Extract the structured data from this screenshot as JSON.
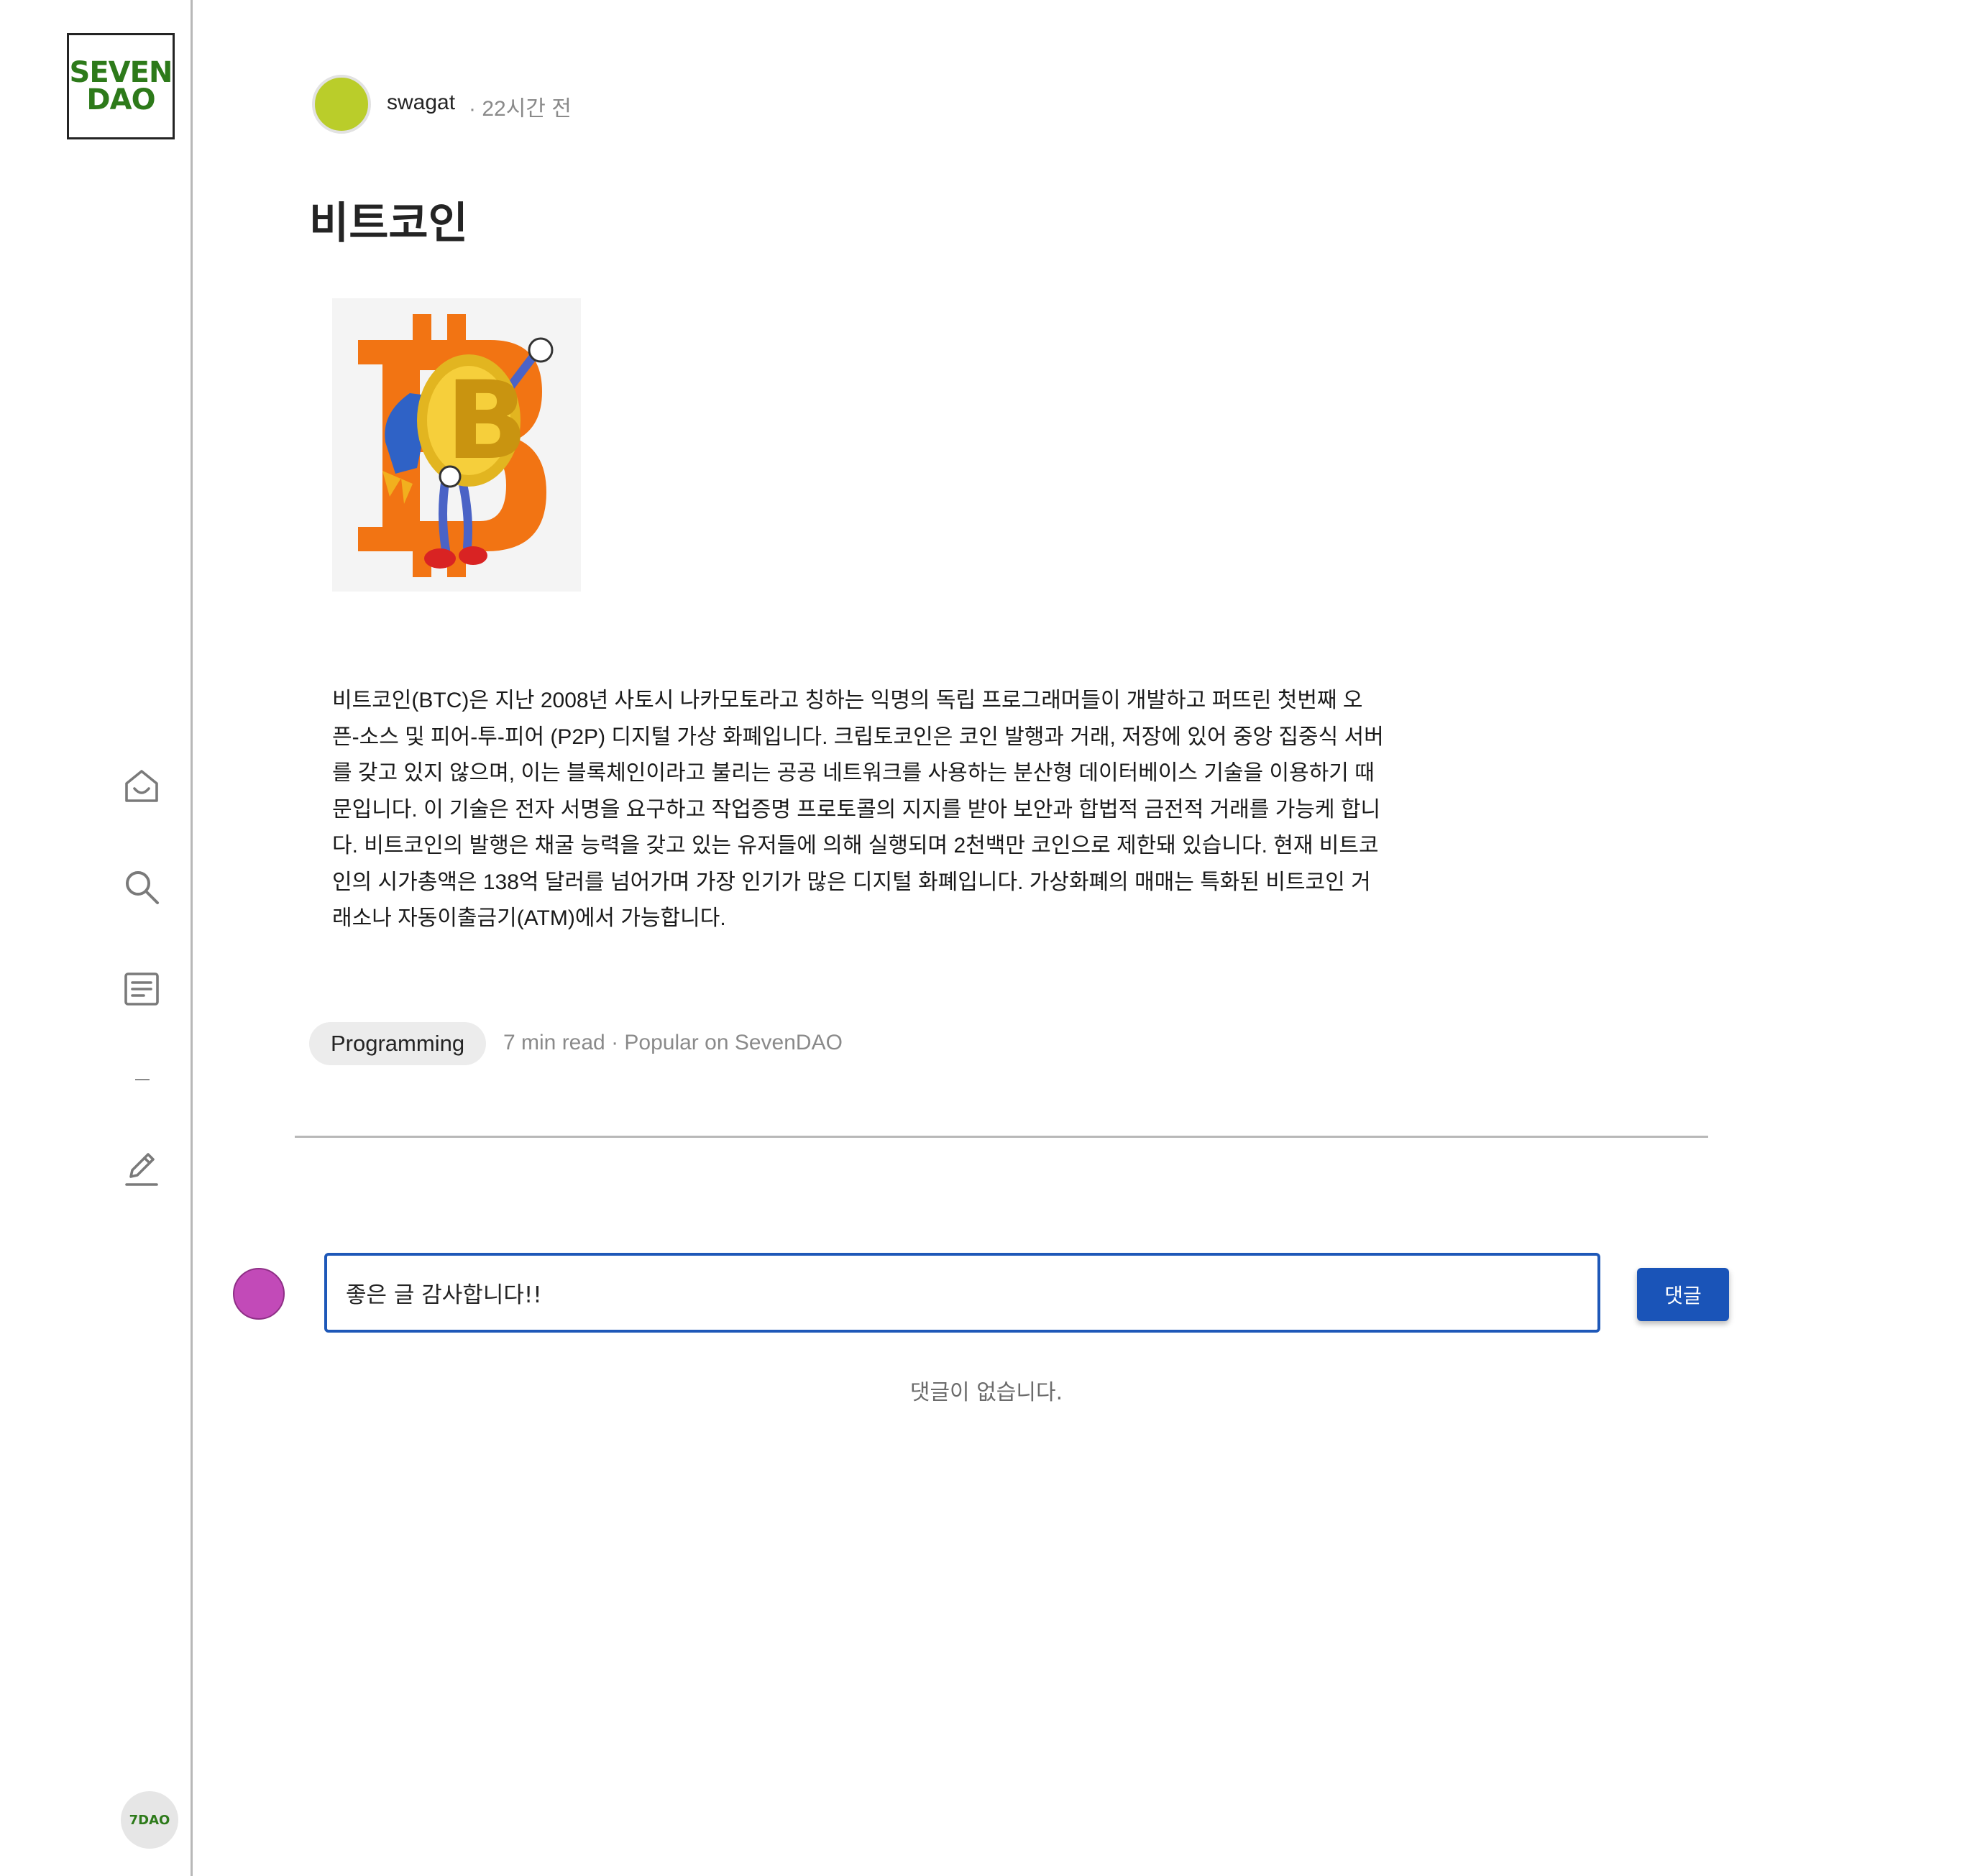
{
  "sidebar": {
    "logo_line1": "SEVEN",
    "logo_line2": "DAO",
    "nav_icons": [
      "home-icon",
      "search-icon",
      "list-icon",
      "write-icon"
    ],
    "profile_badge": "7DAO"
  },
  "post": {
    "author": "swagat",
    "time": "· 22시간 전",
    "title": "비트코인",
    "body": "비트코인(BTC)은 지난 2008년 사토시 나카모토라고 칭하는 익명의 독립 프로그래머들이 개발하고 퍼뜨린 첫번째 오픈-소스 및 피어-투-피어 (P2P) 디지털 가상 화폐입니다. 크립토코인은 코인 발행과 거래, 저장에 있어 중앙 집중식 서버를 갖고 있지 않으며, 이는 블록체인이라고 불리는 공공 네트워크를 사용하는 분산형 데이터베이스 기술을 이용하기 때문입니다. 이 기술은 전자 서명을 요구하고 작업증명 프로토콜의 지지를 받아 보안과 합법적 금전적 거래를 가능케 합니다. 비트코인의 발행은 채굴 능력을 갖고 있는 유저들에 의해 실행되며 2천백만 코인으로 제한돼 있습니다. 현재 비트코인의 시가총액은 138억 달러를 넘어가며 가장 인기가 많은 디지털 화폐입니다. 가상화폐의 매매는 특화된 비트코인 거래소나 자동이출금기(ATM)에서 가능합니다.",
    "tag": "Programming",
    "meta": "7 min read · Popular on SevenDAO"
  },
  "comments": {
    "input_value": "좋은 글 감사합니다!!",
    "submit_label": "댓글",
    "empty_message": "댓글이 없습니다."
  },
  "colors": {
    "brand_green": "#2d7a1a",
    "author_avatar": "#bacd2a",
    "commenter_avatar": "#c24ab8",
    "button_blue": "#1a54b8",
    "input_border": "#1e58b8"
  }
}
